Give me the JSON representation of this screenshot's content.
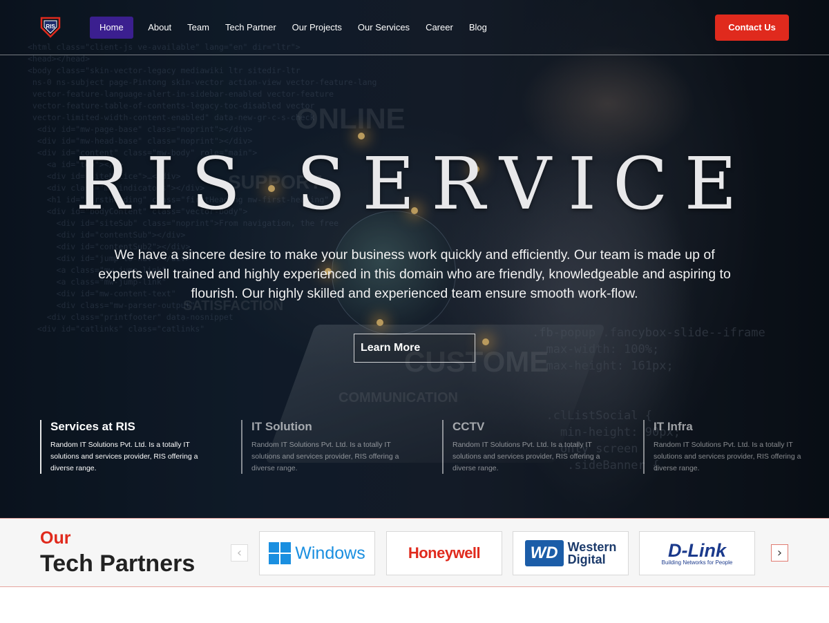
{
  "nav": {
    "items": [
      {
        "label": "Home",
        "active": true
      },
      {
        "label": "About"
      },
      {
        "label": "Team"
      },
      {
        "label": "Tech Partner"
      },
      {
        "label": "Our Projects"
      },
      {
        "label": "Our Services"
      },
      {
        "label": "Career"
      },
      {
        "label": "Blog"
      }
    ],
    "contact_label": "Contact Us"
  },
  "brand": {
    "logo_text": "RIS",
    "accent_color": "#e02a1d",
    "nav_active_color": "#3b1f8f"
  },
  "hero": {
    "title": "RIS SERVICE",
    "description": "We have a sincere desire to make your business work quickly and efficiently. Our team is made up of experts well trained and highly experienced in this domain who are friendly, knowledgeable and aspiring to flourish. Our highly skilled and experienced team ensure smooth work-flow.",
    "cta_label": "Learn More",
    "background_words": [
      "ONLINE",
      "SUPPORT",
      "SATISFACTION",
      "CUSTOME",
      "COMMUNICATION"
    ]
  },
  "features": [
    {
      "title": "Services at RIS",
      "text": "Random IT Solutions Pvt. Ltd. Is a totally IT solutions and services provider, RIS offering a diverse range.",
      "active": true
    },
    {
      "title": "IT Solution",
      "text": "Random IT Solutions Pvt. Ltd. Is a totally IT solutions and services provider, RIS offering a diverse range.",
      "active": false
    },
    {
      "title": "CCTV",
      "text": "Random IT Solutions Pvt. Ltd. Is a totally IT solutions and services provider, RIS offering a diverse range.",
      "active": false
    },
    {
      "title": "IT Infra",
      "text": "Random IT Solutions Pvt. Ltd. Is a totally IT solutions and services provider, RIS offering a diverse range.",
      "active": false
    }
  ],
  "partners": {
    "heading_accent": "Our",
    "heading": "Tech Partners",
    "prev_icon": "chevron-left-icon",
    "next_icon": "chevron-right-icon",
    "logos": [
      {
        "name": "Windows"
      },
      {
        "name": "Honeywell"
      },
      {
        "name": "Western Digital",
        "mark": "WD",
        "line1": "Western",
        "line2": "Digital"
      },
      {
        "name": "D-Link",
        "tagline": "Building Networks for People"
      }
    ]
  }
}
